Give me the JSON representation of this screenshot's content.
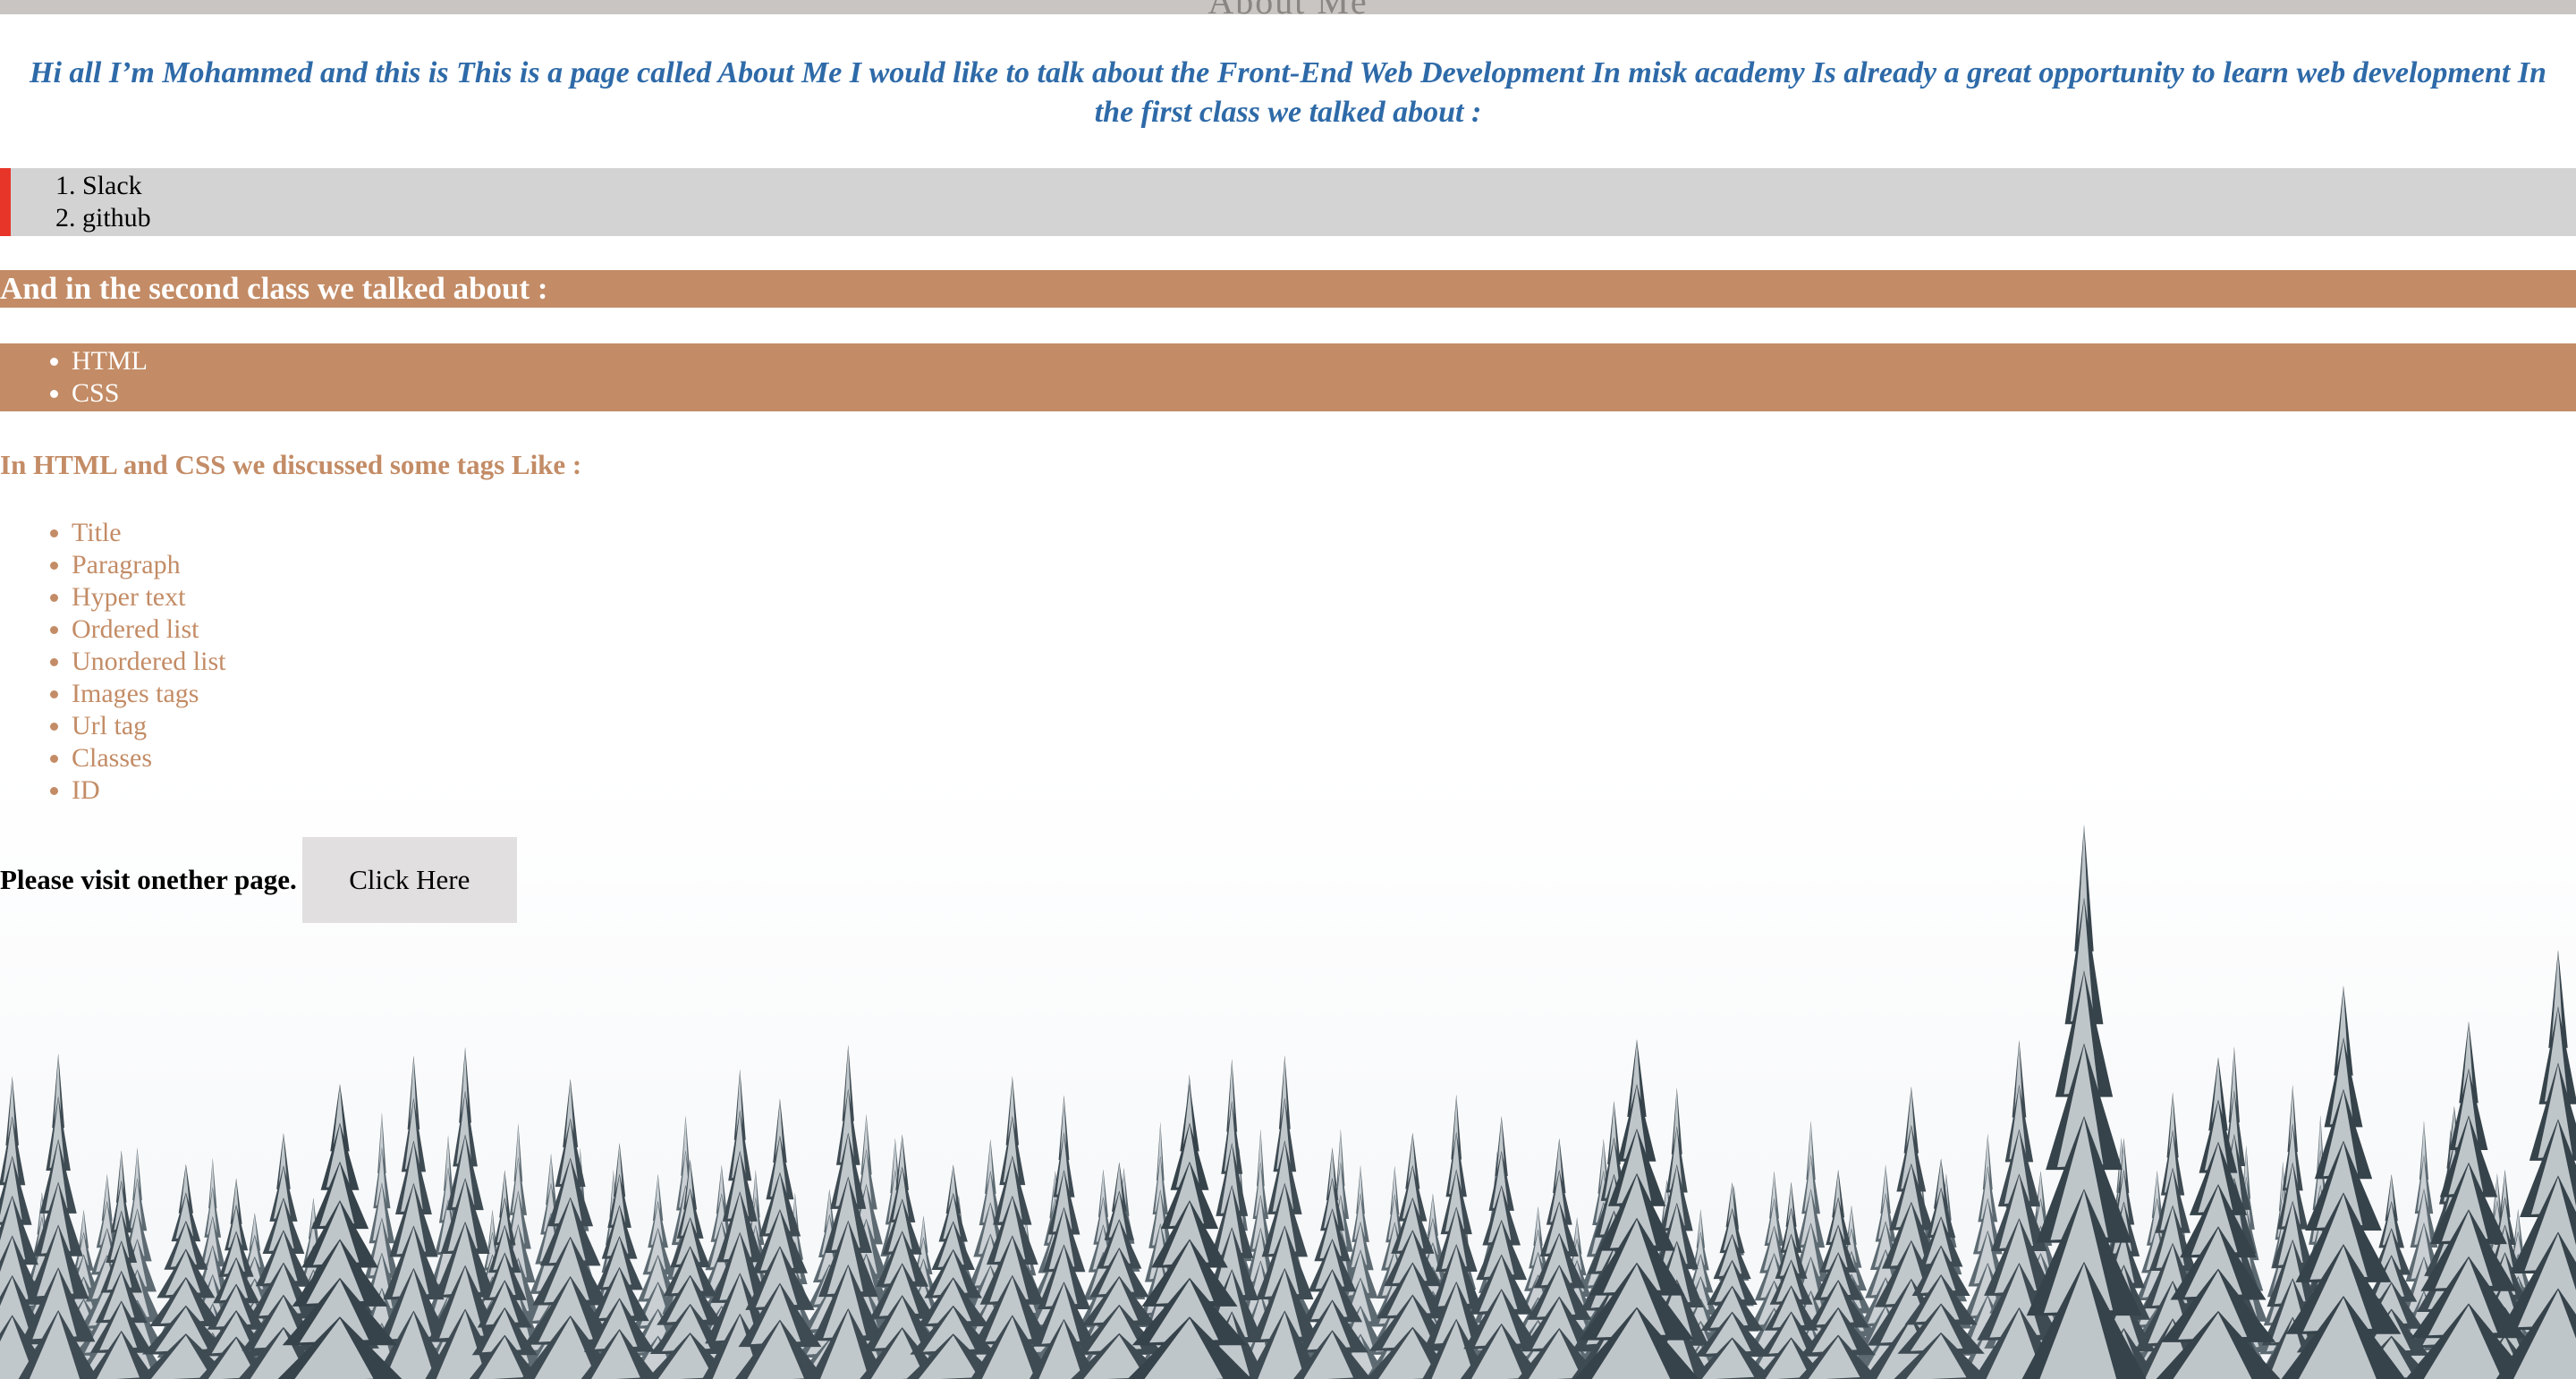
{
  "header": {
    "partial_title": "About Me"
  },
  "intro_text": "Hi all I’m Mohammed and this is This is a page called About Me I would like to talk about the Front-End Web Development In misk academy Is already a great opportunity to learn web development In the first class we talked about :",
  "first_class": {
    "items": [
      "Slack",
      "github"
    ]
  },
  "second_class": {
    "heading": "And in the second class we talked about :",
    "items": [
      "HTML",
      "CSS"
    ]
  },
  "tags": {
    "heading": "In HTML and CSS we discussed some tags Like :",
    "items": [
      "Title",
      "Paragraph",
      "Hyper text",
      "Ordered list",
      "Unordered list",
      "Images tags",
      "Url tag",
      "Classes",
      "ID"
    ]
  },
  "visit": {
    "text": "Please visit onether page.",
    "button_label": "Click Here"
  },
  "colors": {
    "accent_blue": "#2e6aa8",
    "brown": "#c38c66",
    "red_border": "#e8352a",
    "gray_band": "#d3d3d3"
  },
  "background_image": "snowy-pine-forest"
}
